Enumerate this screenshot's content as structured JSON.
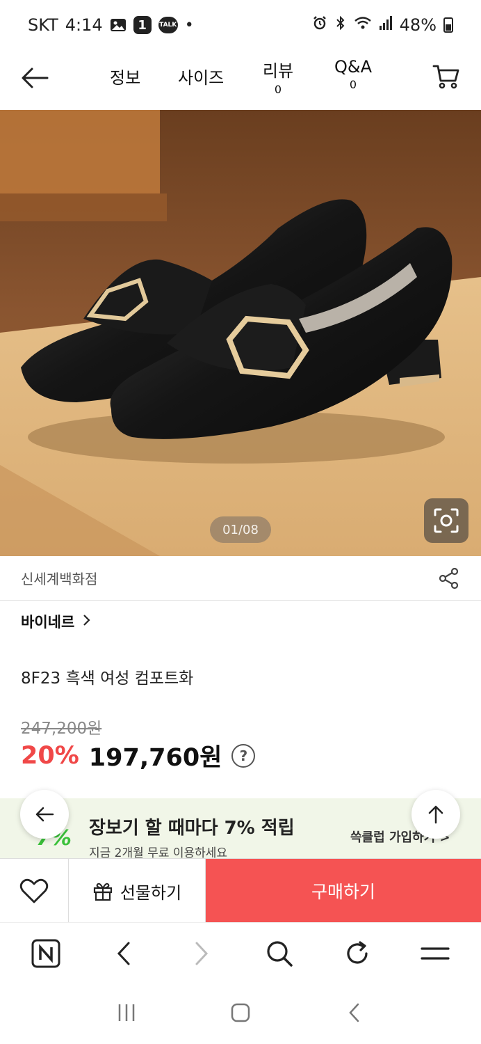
{
  "status_bar": {
    "carrier": "SKT",
    "time": "4:14",
    "notif_badge": "1",
    "talk_label": "TALK",
    "dot": "•",
    "battery": "48%"
  },
  "nav": {
    "tabs": [
      {
        "label": "정보"
      },
      {
        "label": "사이즈"
      },
      {
        "label": "리뷰",
        "count": "0"
      },
      {
        "label": "Q&A",
        "count": "0"
      }
    ]
  },
  "hero": {
    "image_counter": "01/08"
  },
  "seller": {
    "name": "신세계백화점"
  },
  "product": {
    "brand": "바이네르",
    "title": "8F23 흑색 여성 컴포트화",
    "original_price": "247,200원",
    "discount": "20%",
    "price": "197,760원",
    "help_mark": "?"
  },
  "promo": {
    "percent_badge": "7%",
    "headline": "장보기 할 때마다 7% 적립",
    "sub": "지금 2개월 무료 이용하세요",
    "join": "쓱클럽 가입하기 >"
  },
  "actions": {
    "gift_label": "선물하기",
    "buy_label": "구매하기"
  },
  "colors": {
    "accent_red": "#f55353",
    "discount_red": "#f04848",
    "promo_bg": "#f1f6e8",
    "promo_green": "#3ac13a"
  },
  "icons": [
    "back-arrow-icon",
    "cart-icon",
    "camera-lens-icon",
    "share-icon",
    "chevron-right-icon",
    "heart-icon",
    "gift-icon",
    "naver-icon",
    "browser-back-icon",
    "browser-forward-icon",
    "search-icon",
    "refresh-icon",
    "menu-icon",
    "recents-icon",
    "home-icon",
    "system-back-icon",
    "arrow-up-icon"
  ]
}
